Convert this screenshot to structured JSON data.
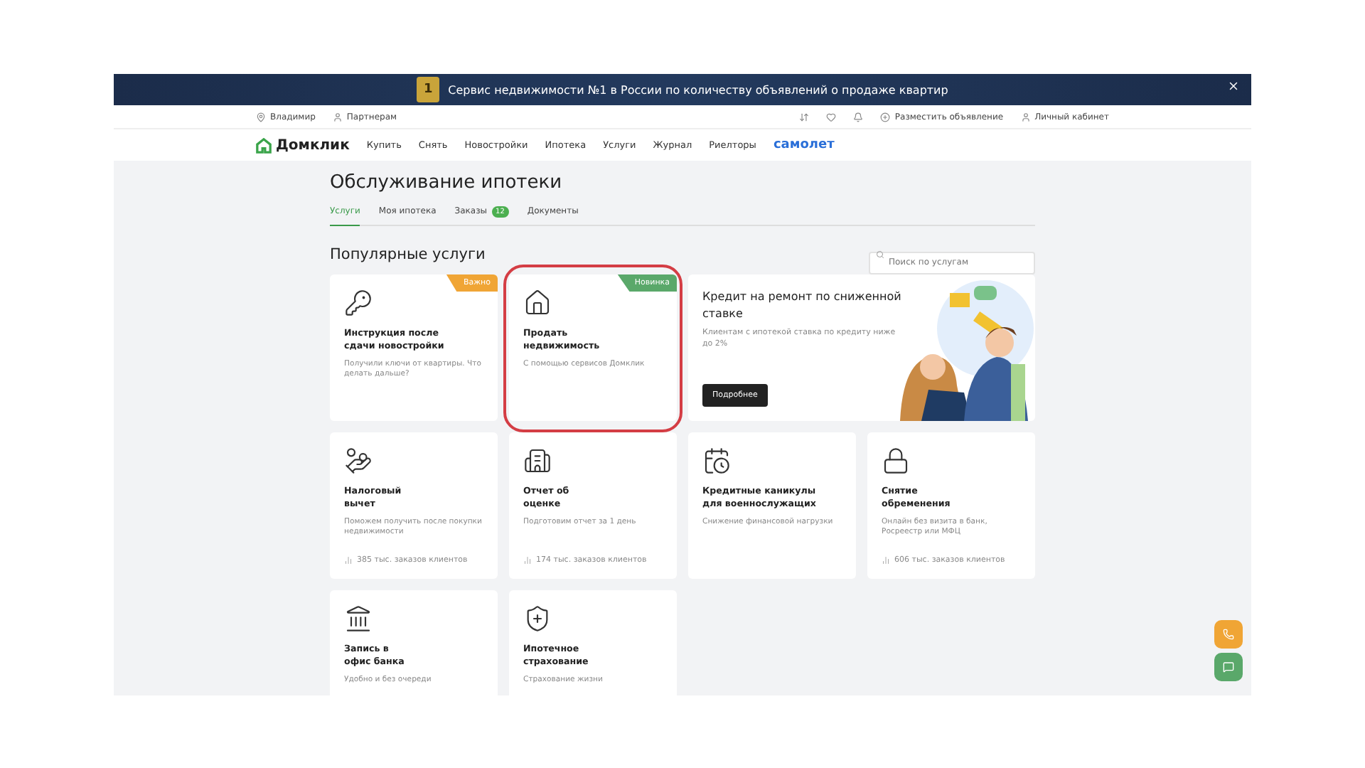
{
  "banner": {
    "rank": "1",
    "text": "Сервис недвижимости №1 в России по количеству объявлений о продаже квартир"
  },
  "top_bar": {
    "left": [
      {
        "kind": "pin",
        "label": "Владимир"
      },
      {
        "kind": "person",
        "label": "Партнерам"
      }
    ],
    "right": [
      {
        "kind": "compare"
      },
      {
        "kind": "heart"
      },
      {
        "kind": "bell"
      },
      {
        "kind": "plus",
        "label": "Разместить объявление"
      },
      {
        "kind": "person",
        "label": "Личный кабинет"
      }
    ]
  },
  "nav": {
    "logo": "Домклик",
    "links": [
      "Купить",
      "Снять",
      "Новостройки",
      "Ипотека",
      "Услуги",
      "Журнал",
      "Риелторы"
    ],
    "partner": "самолет"
  },
  "title": "Обслуживание ипотеки",
  "tabs": [
    {
      "label": "Услуги",
      "selected": true
    },
    {
      "label": "Моя ипотека",
      "selected": false
    },
    {
      "label": "Заказы",
      "selected": false,
      "count": "12"
    },
    {
      "label": "Документы",
      "selected": false
    }
  ],
  "section_title": "Популярные услуги",
  "search": {
    "placeholder": "Поиск по услугам"
  },
  "cards": [
    {
      "kind": "service",
      "title": "Инструкция после сдачи новостройки",
      "description": "Получили ключи от квартиры. Что делать дальше?",
      "badge": {
        "label": "Важно",
        "color": "#f0a535"
      },
      "highlighted": false
    },
    {
      "kind": "service",
      "title": "Продать недвижимость",
      "description": "С помощью сервисов Домклик",
      "badge": {
        "label": "Новинка",
        "color": "#5aa86a"
      },
      "highlighted": true
    },
    {
      "kind": "promo",
      "title": "Кредит на ремонт по сниженной ставке",
      "description": "Клиентам с ипотекой ставка по кредиту ниже до 2%",
      "button": "Подробнее"
    },
    {
      "kind": "service",
      "title": "Налоговый вычет",
      "description": "Поможем получить после покупки недвижимости",
      "stats": "385 тыс. заказов клиентов",
      "highlighted": false
    },
    {
      "kind": "service",
      "title": "Отчет об оценке",
      "description": "Подготовим отчет за 1 день",
      "stats": "174 тыс. заказов клиентов",
      "highlighted": false
    },
    {
      "kind": "service",
      "title": "Кредитные каникулы для военнослужащих",
      "description": "Снижение финансовой нагрузки",
      "highlighted": false
    },
    {
      "kind": "service",
      "title": "Снятие обременения",
      "description": "Онлайн без визита в банк, Росреестр или МФЦ",
      "stats": "606 тыс. заказов клиентов",
      "highlighted": false
    },
    {
      "kind": "service",
      "title": "Запись в офис банка",
      "description": "Удобно и без очереди",
      "highlighted": false
    },
    {
      "kind": "service",
      "title": "Ипотечное страхование",
      "description": "Страхование жизни",
      "highlighted": false
    }
  ]
}
